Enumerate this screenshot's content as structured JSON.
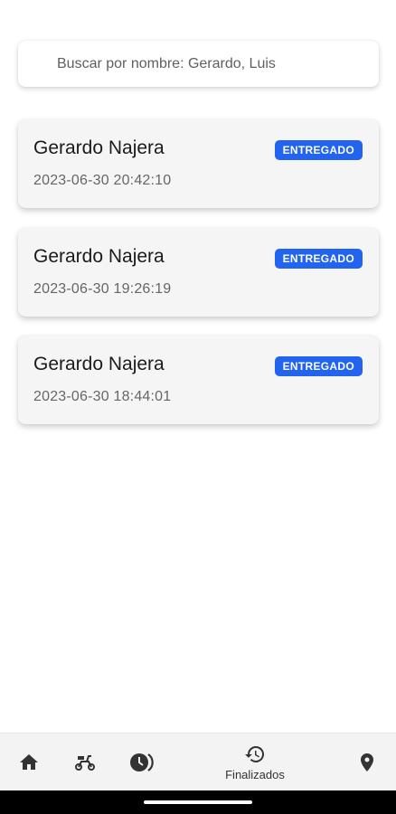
{
  "search": {
    "placeholder": "Buscar por nombre: Gerardo, Luis",
    "value": ""
  },
  "orders": [
    {
      "name": "Gerardo Najera",
      "datetime": "2023-06-30 20:42:10",
      "status": "ENTREGADO"
    },
    {
      "name": "Gerardo Najera",
      "datetime": "2023-06-30 19:26:19",
      "status": "ENTREGADO"
    },
    {
      "name": "Gerardo Najera",
      "datetime": "2023-06-30 18:44:01",
      "status": "ENTREGADO"
    }
  ],
  "nav": {
    "items": [
      {
        "icon": "home-icon"
      },
      {
        "icon": "scooter-icon"
      },
      {
        "icon": "schedule-icon"
      },
      {
        "icon": "history-icon",
        "label": "Finalizados",
        "active": true
      },
      {
        "icon": "location-pin-icon"
      }
    ]
  },
  "colors": {
    "badge": "#2264f0",
    "card_background": "#f5f5f5",
    "nav_background": "#f3f3f3",
    "icon": "#333333"
  }
}
